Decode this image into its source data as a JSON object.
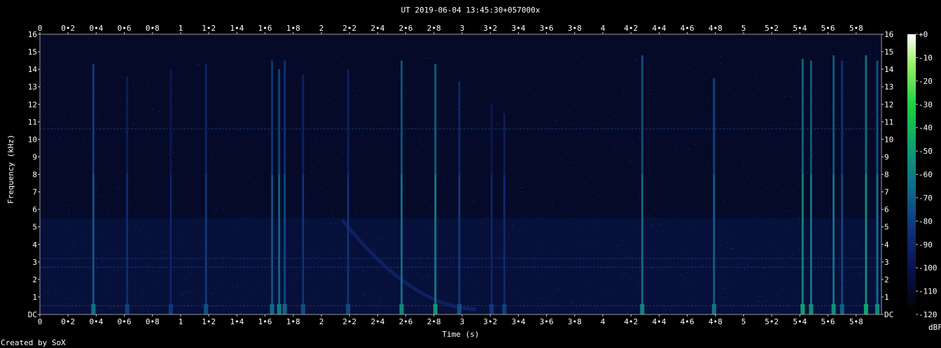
{
  "title": "UT 2019-06-04 13:45:30+057000x",
  "credit": "Created by SoX",
  "chart_data": {
    "type": "heatmap",
    "title": "UT 2019-06-04 13:45:30+057000x",
    "xlabel": "Time (s)",
    "ylabel": "Frequency (kHz)",
    "xlim": [
      0,
      5.98
    ],
    "ylim": [
      0,
      16
    ],
    "x_ticks": [
      "0",
      "0•2",
      "0•4",
      "0•6",
      "0•8",
      "1",
      "1•2",
      "1•4",
      "1•6",
      "1•8",
      "2",
      "2•2",
      "2•4",
      "2•6",
      "2•8",
      "3",
      "3•2",
      "3•4",
      "3•6",
      "3•8",
      "4",
      "4•2",
      "4•4",
      "4•6",
      "4•8",
      "5",
      "5•2",
      "5•4",
      "5•6",
      "5•8"
    ],
    "y_ticks": [
      "DC",
      "1",
      "2",
      "3",
      "4",
      "5",
      "6",
      "7",
      "8",
      "9",
      "10",
      "11",
      "12",
      "13",
      "14",
      "15",
      "16"
    ],
    "colorbar": {
      "label": "dBFS",
      "ticks": [
        "+0",
        "-10",
        "-20",
        "-30",
        "-40",
        "-50",
        "-60",
        "-70",
        "-80",
        "-90",
        "-100",
        "-110",
        "-120"
      ],
      "range": [
        -120,
        0
      ],
      "colors": [
        "#000000",
        "#0a0f48",
        "#10307a",
        "#106a8a",
        "#10a070",
        "#20d040",
        "#a0f070",
        "#ffffff"
      ]
    },
    "background_level_dbfs": -100,
    "hum_lines_khz": [
      10.6,
      3.2,
      2.7,
      0.5
    ],
    "transients": [
      {
        "t": 0.38,
        "top_khz": 14.3,
        "level": -70
      },
      {
        "t": 0.62,
        "top_khz": 13.6,
        "level": -85
      },
      {
        "t": 0.93,
        "top_khz": 14.0,
        "level": -88
      },
      {
        "t": 1.18,
        "top_khz": 14.3,
        "level": -80
      },
      {
        "t": 1.65,
        "top_khz": 14.5,
        "level": -72
      },
      {
        "t": 1.7,
        "top_khz": 14.0,
        "level": -66
      },
      {
        "t": 1.74,
        "top_khz": 14.5,
        "level": -74
      },
      {
        "t": 1.87,
        "top_khz": 13.7,
        "level": -82
      },
      {
        "t": 2.19,
        "top_khz": 14.0,
        "level": -82
      },
      {
        "t": 2.57,
        "top_khz": 14.5,
        "level": -62
      },
      {
        "t": 2.81,
        "top_khz": 14.3,
        "level": -58
      },
      {
        "t": 2.98,
        "top_khz": 13.3,
        "level": -80
      },
      {
        "t": 3.21,
        "top_khz": 12.0,
        "level": -88
      },
      {
        "t": 3.3,
        "top_khz": 11.5,
        "level": -85
      },
      {
        "t": 4.28,
        "top_khz": 14.8,
        "level": -64
      },
      {
        "t": 4.79,
        "top_khz": 13.5,
        "level": -68
      },
      {
        "t": 5.42,
        "top_khz": 14.6,
        "level": -55
      },
      {
        "t": 5.48,
        "top_khz": 14.5,
        "level": -60
      },
      {
        "t": 5.64,
        "top_khz": 14.8,
        "level": -60
      },
      {
        "t": 5.7,
        "top_khz": 14.5,
        "level": -75
      },
      {
        "t": 5.87,
        "top_khz": 14.8,
        "level": -52
      },
      {
        "t": 5.95,
        "top_khz": 14.5,
        "level": -62
      }
    ],
    "sweep": {
      "t_start": 2.15,
      "f_start_khz": 5.4,
      "t_end": 3.1,
      "f_end_khz": 0.3,
      "level": -88
    }
  }
}
